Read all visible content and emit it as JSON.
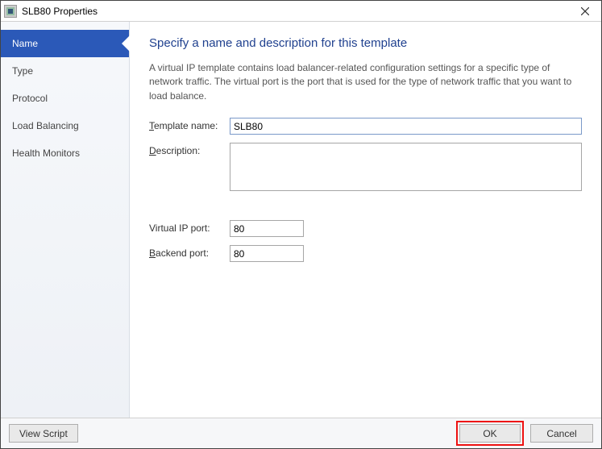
{
  "window": {
    "title": "SLB80 Properties"
  },
  "sidebar": {
    "items": [
      {
        "label": "Name",
        "active": true
      },
      {
        "label": "Type",
        "active": false
      },
      {
        "label": "Protocol",
        "active": false
      },
      {
        "label": "Load Balancing",
        "active": false
      },
      {
        "label": "Health Monitors",
        "active": false
      }
    ]
  },
  "content": {
    "heading": "Specify a name and description for this template",
    "description": "A virtual IP template contains load balancer-related configuration settings for a specific type of network traffic. The virtual port is the port that is used for the type of network traffic that you want to load balance.",
    "template_name_label": "Template name:",
    "template_name_value": "SLB80",
    "description_label": "Description:",
    "description_value": "",
    "virtual_ip_port_label": "Virtual IP port:",
    "virtual_ip_port_value": "80",
    "backend_port_label": "Backend port:",
    "backend_port_value": "80"
  },
  "footer": {
    "view_script": "View Script",
    "ok": "OK",
    "cancel": "Cancel"
  }
}
